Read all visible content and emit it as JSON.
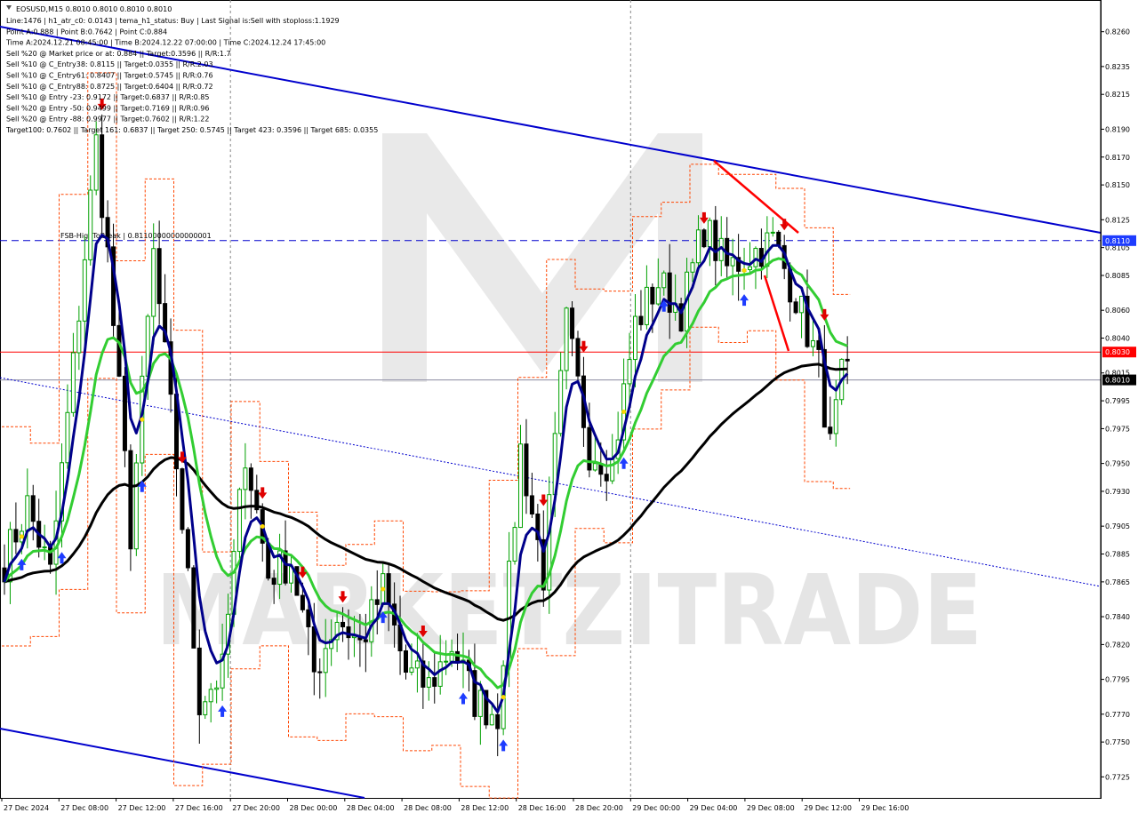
{
  "symbol_header": "EOSUSD,M15  0.8010 0.8010 0.8010 0.8010",
  "info_lines": [
    "Line:1476  |  h1_atr_c0: 0.0143  |  tema_h1_status: Buy  |  Last Signal is:Sell with stoploss:1.1929",
    "Point A:0.888  |  Point B:0.7642  |  Point C:0.884",
    "Time A:2024.12.21 08:45:00  |  Time B:2024.12.22 07:00:00  |  Time C:2024.12.24 17:45:00",
    "Sell %20 @ Market price or at: 0.884  ||  Target:0.3596  ||  R/R:1.7",
    "Sell %10 @ C_Entry38: 0.8115  ||  Target:0.0355  ||  R/R:2.03",
    "Sell %10 @ C_Entry61: 0.8407  ||  Target:0.5745  ||  R/R:0.76",
    "Sell %10 @ C_Entry88: 0.8725  ||  Target:0.6404  ||  R/R:0.72",
    "Sell %10 @ Entry -23: 0.9172  ||  Target:0.6837  ||  R/R:0.85",
    "Sell %20 @ Entry -50: 0.9499  ||  Target:0.7169  ||  R/R:0.96",
    "Sell %20 @ Entry -88: 0.9977  ||  Target:0.7602  ||  R/R:1.22",
    "Target100: 0.7602  ||  Target 161: 0.6837  ||  Target 250: 0.5745  ||  Target 423: 0.3596  ||  Target 685: 0.0355"
  ],
  "fsb_label": "FSB-HighToBreak  |  0.81100000000000001",
  "watermark": "MARKETZITRADE",
  "colors": {
    "bull": "#00a000",
    "bear": "#000000",
    "navy_ma": "#00008b",
    "green_ma": "#32cd32",
    "black_ma": "#000000",
    "trend": "#0000cd",
    "orange": "#ff4500",
    "red_line": "#ff0000",
    "marker_blue": "#1e3cff",
    "marker_red": "#e00000",
    "marker_yellow": "#ffd700"
  },
  "price_levels": {
    "fsb": 0.811,
    "red": 0.803,
    "current": 0.801
  },
  "price_badges": [
    {
      "label": "0.8110",
      "value": 0.811,
      "color": "#1e3cff"
    },
    {
      "label": "0.8030",
      "value": 0.803,
      "color": "#ff0000"
    },
    {
      "label": "0.8010",
      "value": 0.801,
      "color": "#000000"
    }
  ],
  "chart_data": {
    "type": "candlestick",
    "title": "EOSUSD,M15",
    "ylim": [
      0.7715,
      0.827
    ],
    "y_ticks": [
      "0.8260",
      "0.8235",
      "0.8215",
      "0.8190",
      "0.8170",
      "0.8150",
      "0.8125",
      "0.8105",
      "0.8085",
      "0.8060",
      "0.8040",
      "0.8015",
      "0.7995",
      "0.7975",
      "0.7950",
      "0.7930",
      "0.7905",
      "0.7885",
      "0.7865",
      "0.7840",
      "0.7820",
      "0.7795",
      "0.7770",
      "0.7750",
      "0.7725"
    ],
    "x_ticks": [
      "27 Dec 2024",
      "27 Dec 08:00",
      "27 Dec 12:00",
      "27 Dec 16:00",
      "27 Dec 20:00",
      "28 Dec 00:00",
      "28 Dec 04:00",
      "28 Dec 08:00",
      "28 Dec 12:00",
      "28 Dec 16:00",
      "28 Dec 20:00",
      "29 Dec 00:00",
      "29 Dec 04:00",
      "29 Dec 08:00",
      "29 Dec 12:00",
      "29 Dec 16:00"
    ],
    "vertical_separators": [
      "27 Dec 20:00",
      "29 Dec 00:00"
    ],
    "close_path": [
      {
        "x": 0,
        "y": 0.788
      },
      {
        "x": 4,
        "y": 0.792
      },
      {
        "x": 8,
        "y": 0.787
      },
      {
        "x": 12,
        "y": 0.802
      },
      {
        "x": 16,
        "y": 0.818
      },
      {
        "x": 18,
        "y": 0.81
      },
      {
        "x": 22,
        "y": 0.79
      },
      {
        "x": 26,
        "y": 0.81
      },
      {
        "x": 30,
        "y": 0.795
      },
      {
        "x": 34,
        "y": 0.778
      },
      {
        "x": 38,
        "y": 0.78
      },
      {
        "x": 42,
        "y": 0.796
      },
      {
        "x": 46,
        "y": 0.787
      },
      {
        "x": 50,
        "y": 0.788
      },
      {
        "x": 54,
        "y": 0.78
      },
      {
        "x": 58,
        "y": 0.784
      },
      {
        "x": 62,
        "y": 0.782
      },
      {
        "x": 66,
        "y": 0.786
      },
      {
        "x": 70,
        "y": 0.78
      },
      {
        "x": 74,
        "y": 0.779
      },
      {
        "x": 78,
        "y": 0.782
      },
      {
        "x": 82,
        "y": 0.778
      },
      {
        "x": 86,
        "y": 0.777
      },
      {
        "x": 90,
        "y": 0.796
      },
      {
        "x": 94,
        "y": 0.787
      },
      {
        "x": 98,
        "y": 0.805
      },
      {
        "x": 102,
        "y": 0.796
      },
      {
        "x": 106,
        "y": 0.795
      },
      {
        "x": 110,
        "y": 0.805
      },
      {
        "x": 114,
        "y": 0.808
      },
      {
        "x": 118,
        "y": 0.806
      },
      {
        "x": 122,
        "y": 0.812
      },
      {
        "x": 126,
        "y": 0.809
      },
      {
        "x": 130,
        "y": 0.81
      },
      {
        "x": 134,
        "y": 0.811
      },
      {
        "x": 138,
        "y": 0.807
      },
      {
        "x": 142,
        "y": 0.802
      },
      {
        "x": 144,
        "y": 0.796
      },
      {
        "x": 146,
        "y": 0.801
      }
    ],
    "n_bars": 148
  }
}
